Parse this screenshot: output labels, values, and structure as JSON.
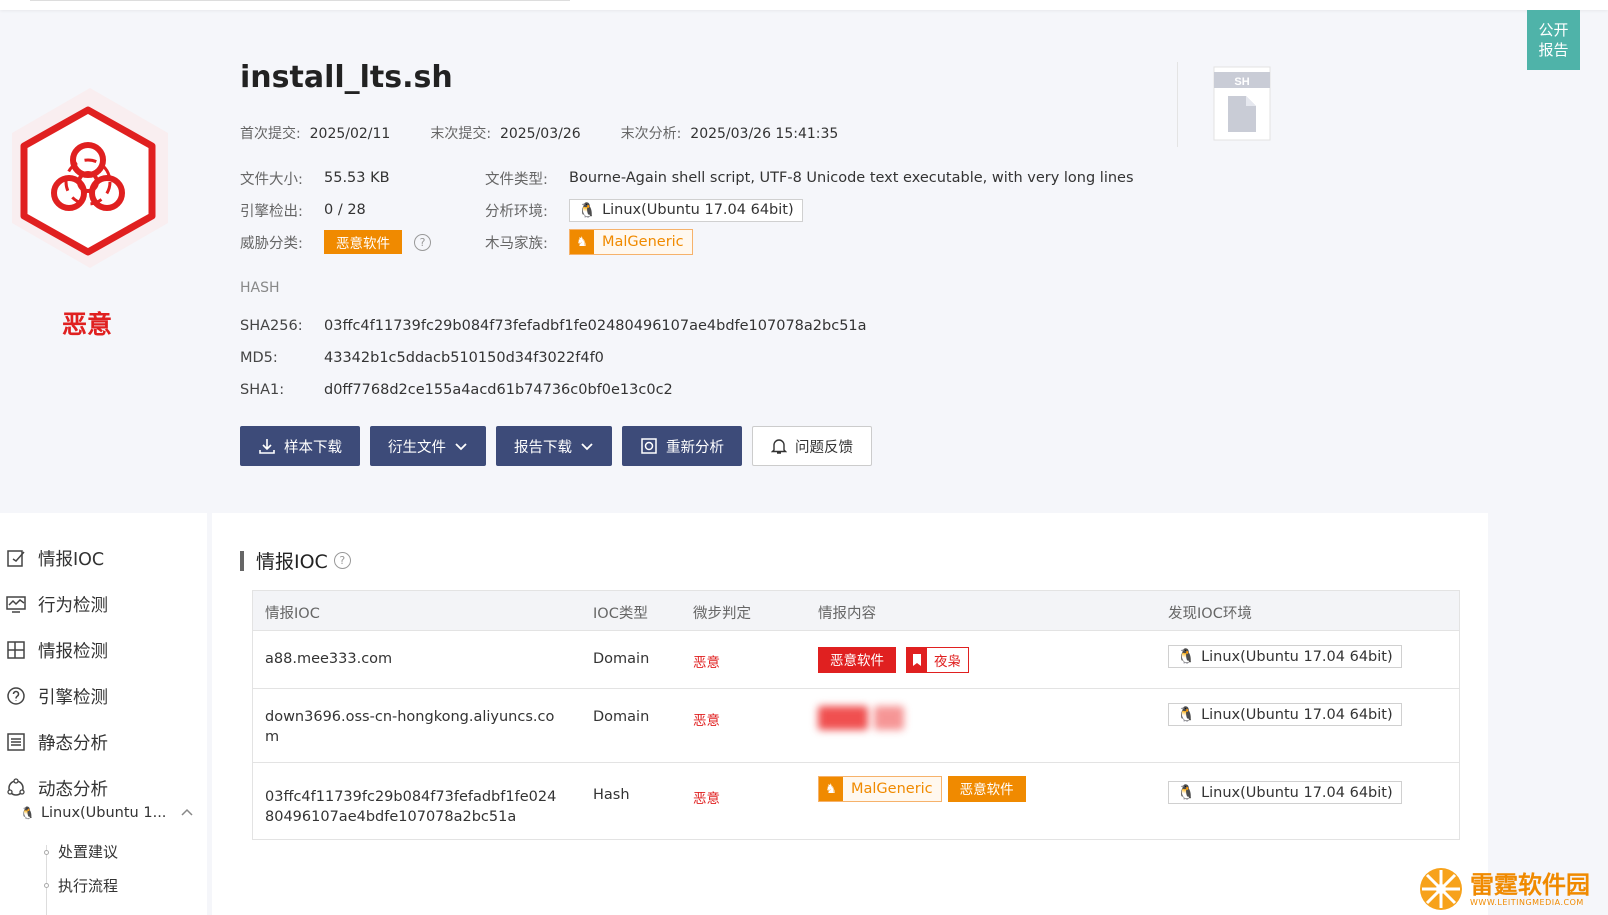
{
  "public_report": {
    "line1": "公开",
    "line2": "报告"
  },
  "verdict_label": "恶意",
  "file_title": "install_lts.sh",
  "file_ext": "SH",
  "dates": [
    {
      "label": "首次提交:",
      "value": "2025/02/11"
    },
    {
      "label": "末次提交:",
      "value": "2025/03/26"
    },
    {
      "label": "末次分析:",
      "value": "2025/03/26 15:41:35"
    }
  ],
  "info": {
    "size_label": "文件大小:",
    "size": "55.53 KB",
    "type_label": "文件类型:",
    "type": "Bourne-Again shell script, UTF-8 Unicode text executable, with very long lines",
    "engine_label": "引擎检出:",
    "engine": "0 / 28",
    "env_label": "分析环境:",
    "env": "Linux(Ubuntu 17.04 64bit)",
    "threat_label": "威胁分类:",
    "threat": "恶意软件",
    "family_label": "木马家族:",
    "family": "MalGeneric"
  },
  "hash": {
    "title": "HASH",
    "sha256_label": "SHA256:",
    "sha256": "03ffc4f11739fc29b084f73fefadbf1fe02480496107ae4bdfe107078a2bc51a",
    "md5_label": "MD5:",
    "md5": "43342b1c5ddacb510150d34f3022f4f0",
    "sha1_label": "SHA1:",
    "sha1": "d0ff7768d2ce155a4acd61b74736c0bf0e13c0c2"
  },
  "actions": {
    "download": "样本下载",
    "derived": "衍生文件",
    "report": "报告下载",
    "reanalyze": "重新分析",
    "feedback": "问题反馈"
  },
  "sidebar": {
    "items": [
      "情报IOC",
      "行为检测",
      "情报检测",
      "引擎检测",
      "静态分析",
      "动态分析"
    ],
    "sub": "Linux(Ubuntu 1...",
    "leaves": [
      "处置建议",
      "执行流程"
    ]
  },
  "ioc": {
    "title": "情报IOC",
    "headers": [
      "情报IOC",
      "IOC类型",
      "微步判定",
      "情报内容",
      "发现IOC环境"
    ],
    "rows": [
      {
        "ioc": "a88.mee333.com",
        "type": "Domain",
        "verdict": "恶意",
        "tag1": "恶意软件",
        "tag2": "夜枭",
        "env": "Linux(Ubuntu 17.04 64bit)"
      },
      {
        "ioc": "down3696.oss-cn-hongkong.aliyuncs.com",
        "type": "Domain",
        "verdict": "恶意",
        "env": "Linux(Ubuntu 17.04 64bit)"
      },
      {
        "ioc": "03ffc4f11739fc29b084f73fefadbf1fe02480496107ae4bdfe107078a2bc51a",
        "type": "Hash",
        "verdict": "恶意",
        "tag1": "MalGeneric",
        "tag2": "恶意软件",
        "env": "Linux(Ubuntu 17.04 64bit)"
      }
    ]
  },
  "watermark": {
    "name": "雷霆软件园",
    "url": "WWW.LEITINGMEDIA.COM"
  }
}
